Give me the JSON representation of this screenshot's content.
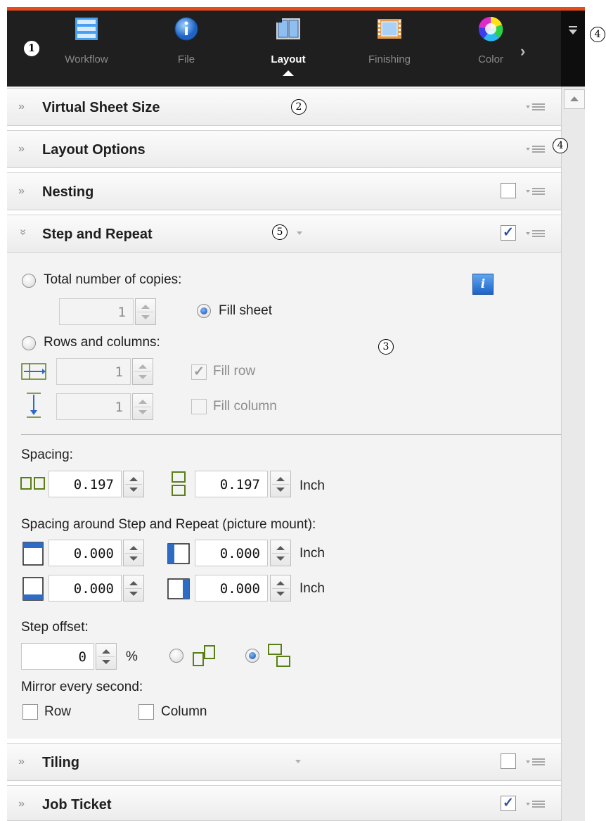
{
  "toolbar": {
    "items": [
      {
        "label": "Workflow",
        "icon": "workflow-icon",
        "active": false
      },
      {
        "label": "File",
        "icon": "info-icon",
        "active": false
      },
      {
        "label": "Layout",
        "icon": "layout-icon",
        "active": true
      },
      {
        "label": "Finishing",
        "icon": "finishing-icon",
        "active": false
      },
      {
        "label": "Color",
        "icon": "color-wheel-icon",
        "active": false
      }
    ],
    "next_icon": "chevron-right-icon",
    "overflow_icon": "dropdown-menu-icon"
  },
  "callouts": {
    "c1": "1",
    "c2": "2",
    "c3": "3",
    "c4a": "4",
    "c4b": "4",
    "c5": "5"
  },
  "sections": {
    "virtual_sheet_size": {
      "title": "Virtual Sheet Size"
    },
    "layout_options": {
      "title": "Layout Options"
    },
    "nesting": {
      "title": "Nesting",
      "checked": false
    },
    "step_and_repeat": {
      "title": "Step and Repeat",
      "checked": true,
      "expanded": true
    },
    "tiling": {
      "title": "Tiling",
      "checked": false
    },
    "job_ticket": {
      "title": "Job Ticket",
      "checked": true
    }
  },
  "step_repeat": {
    "total_copies_label": "Total number of copies:",
    "total_copies_value": "1",
    "fill_sheet_label": "Fill sheet",
    "rows_columns_label": "Rows and columns:",
    "rows_value": "1",
    "columns_value": "1",
    "fill_row_label": "Fill row",
    "fill_column_label": "Fill column",
    "selected_mode": "Fill sheet",
    "info_glyph": "i"
  },
  "spacing": {
    "label": "Spacing:",
    "horizontal": "0.197",
    "vertical": "0.197",
    "unit": "Inch"
  },
  "mount": {
    "label": "Spacing around Step and Repeat (picture mount):",
    "top": "0.000",
    "left": "0.000",
    "bottom": "0.000",
    "right": "0.000",
    "unit1": "Inch",
    "unit2": "Inch"
  },
  "step_offset": {
    "label": "Step offset:",
    "value": "0",
    "unit": "%",
    "selected": "vertical-offset"
  },
  "mirror": {
    "label": "Mirror every second:",
    "row_label": "Row",
    "column_label": "Column",
    "row_checked": false,
    "column_checked": false
  },
  "colors": {
    "accent_orange": "#e84a18",
    "toolbar_bg": "#1f1f1f",
    "icon_green": "#5a7f16",
    "icon_blue": "#2d6bc4"
  }
}
